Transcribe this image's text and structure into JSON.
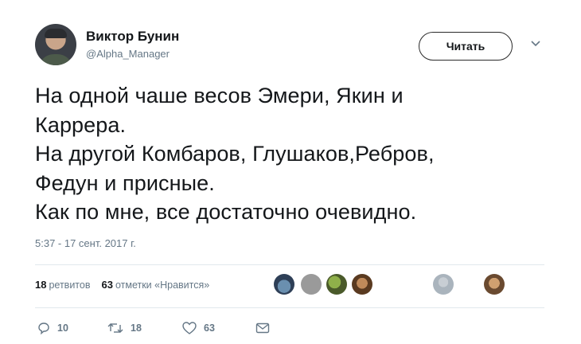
{
  "author": {
    "display_name": "Виктор Бунин",
    "handle": "@Alpha_Manager"
  },
  "follow_label": "Читать",
  "tweet": {
    "text": "На одной чаше весов Эмери, Якин и\nКаррера.\nНа другой Комбаров, Глушаков,Ребров,\nФедун и присные.\nКак по мне, все достаточно очевидно.",
    "timestamp": "5:37 - 17 сент. 2017 г."
  },
  "stats": {
    "retweets_count": "18",
    "retweets_label": "ретвитов",
    "likes_count": "63",
    "likes_label": "отметки «Нравится»"
  },
  "actions": {
    "reply_count": "10",
    "retweet_count": "18",
    "like_count": "63"
  },
  "icons": [
    "chevron-down-icon",
    "reply-icon",
    "retweet-icon",
    "heart-icon",
    "mail-icon"
  ],
  "colors": {
    "text": "#14171a",
    "secondary": "#657786",
    "divider": "#e1e8ed"
  }
}
